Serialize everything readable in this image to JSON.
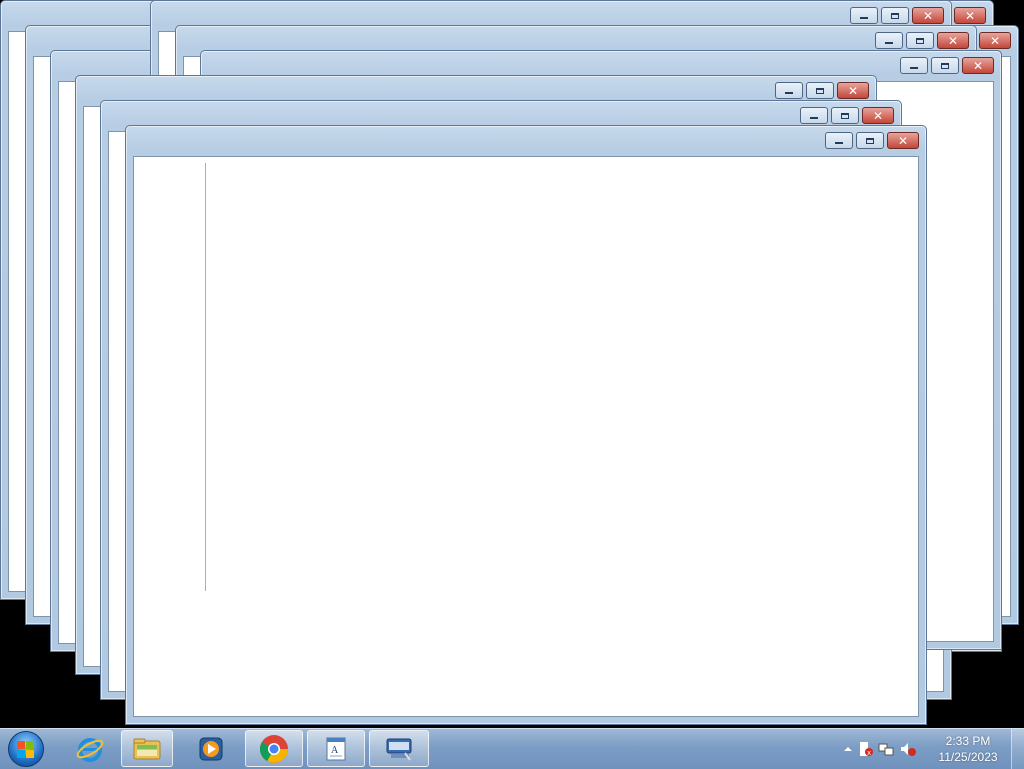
{
  "desktop": {
    "windows_count": 12,
    "caption_buttons": {
      "minimize": "minimize",
      "maximize": "maximize",
      "close": "close"
    }
  },
  "taskbar": {
    "start": {
      "icon": "windows-logo-icon"
    },
    "pinned": [
      {
        "name": "internet-explorer",
        "icon": "internet-explorer-icon"
      },
      {
        "name": "windows-explorer",
        "icon": "folder-icon"
      },
      {
        "name": "windows-media-player",
        "icon": "media-player-icon"
      },
      {
        "name": "google-chrome",
        "icon": "chrome-icon"
      },
      {
        "name": "wordpad",
        "icon": "wordpad-icon"
      },
      {
        "name": "on-screen-keyboard",
        "icon": "keyboard-icon"
      }
    ],
    "tray": {
      "icons": [
        "show-hidden-icons-arrow",
        "action-center-icon",
        "network-icon",
        "volume-muted-icon"
      ],
      "time": "2:33 PM",
      "date": "11/25/2023"
    }
  },
  "colors": {
    "close_button": "#c4463a",
    "taskbar": "#7c9dc4",
    "window_frame": "#b7cde4"
  }
}
